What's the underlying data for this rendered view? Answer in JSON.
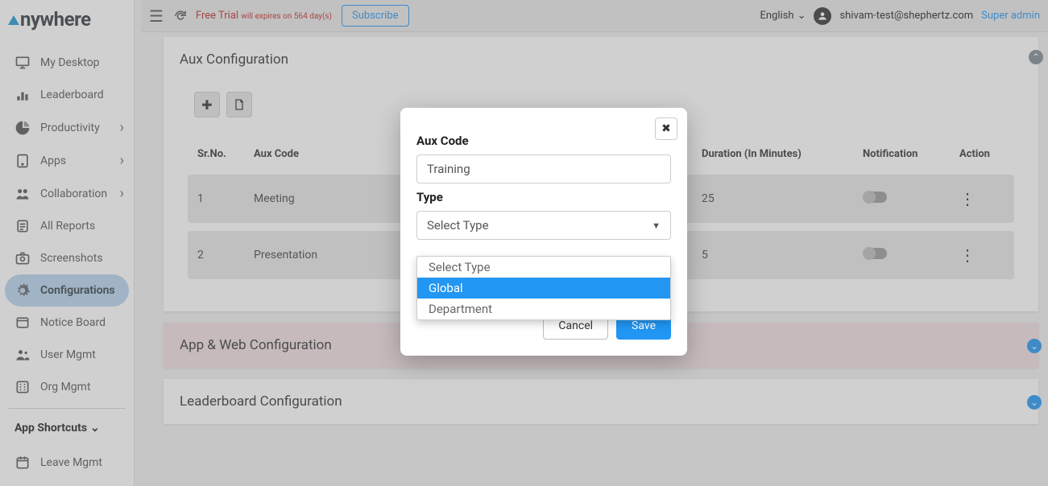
{
  "brand": {
    "name": "nywhere"
  },
  "topbar": {
    "trial_label": "Free Trial",
    "trial_detail": "will expires on 564 day(s)",
    "subscribe": "Subscribe",
    "language": "English",
    "user_email": "shivam-test@shephertz.com",
    "user_role": "Super admin"
  },
  "sidebar": {
    "items": [
      {
        "icon": "monitor-icon",
        "label": "My Desktop"
      },
      {
        "icon": "leaderboard-icon",
        "label": "Leaderboard"
      },
      {
        "icon": "piechart-icon",
        "label": "Productivity",
        "expandable": true
      },
      {
        "icon": "apps-icon",
        "label": "Apps",
        "expandable": true
      },
      {
        "icon": "collab-icon",
        "label": "Collaboration",
        "expandable": true
      },
      {
        "icon": "reports-icon",
        "label": "All Reports"
      },
      {
        "icon": "camera-icon",
        "label": "Screenshots"
      },
      {
        "icon": "gear-icon",
        "label": "Configurations",
        "active": true
      },
      {
        "icon": "notice-icon",
        "label": "Notice Board"
      },
      {
        "icon": "users-icon",
        "label": "User Mgmt"
      },
      {
        "icon": "org-icon",
        "label": "Org Mgmt"
      }
    ],
    "shortcuts_header": "App Shortcuts",
    "shortcuts": [
      {
        "icon": "leave-icon",
        "label": "Leave Mgmt"
      }
    ]
  },
  "cards": {
    "aux": {
      "title": "Aux Configuration",
      "columns": [
        "Sr.No.",
        "Aux Code",
        "",
        "Duration (In Minutes)",
        "Notification",
        "Action"
      ],
      "rows": [
        {
          "sr": "1",
          "code": "Meeting",
          "duration": "25"
        },
        {
          "sr": "2",
          "code": "Presentation",
          "duration": "5"
        }
      ]
    },
    "appweb": {
      "title": "App & Web Configuration"
    },
    "leaderboard": {
      "title": "Leaderboard Configuration"
    }
  },
  "modal": {
    "field1_label": "Aux Code",
    "field1_value": "Training",
    "field2_label": "Type",
    "select_placeholder": "Select Type",
    "options": [
      "Select Type",
      "Global",
      "Department"
    ],
    "highlighted_index": 1,
    "cancel": "Cancel",
    "save": "Save"
  }
}
